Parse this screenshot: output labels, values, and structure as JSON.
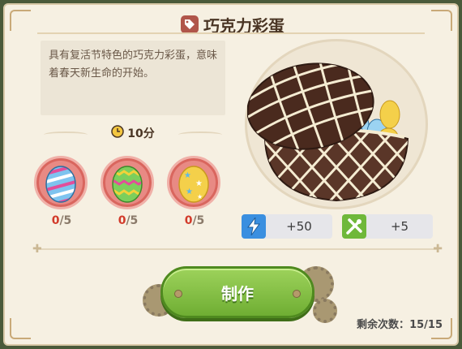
{
  "recipe": {
    "title": "巧克力彩蛋",
    "description": "具有复活节特色的巧克力彩蛋，意味着春天新生命的开始。",
    "time": "10分"
  },
  "ingredients": [
    {
      "icon": "blue-striped-egg-icon",
      "have": "0",
      "need": "/5"
    },
    {
      "icon": "green-zigzag-egg-icon",
      "have": "0",
      "need": "/5"
    },
    {
      "icon": "gold-star-egg-icon",
      "have": "0",
      "need": "/5"
    }
  ],
  "rewards": [
    {
      "icon": "lightning-icon",
      "value": "+50",
      "color": "#3a8fe0"
    },
    {
      "icon": "tools-icon",
      "value": "+5",
      "color": "#6fb83a"
    }
  ],
  "action": {
    "make_label": "制作"
  },
  "remaining": {
    "label": "剩余次数：",
    "value": "15/15"
  }
}
